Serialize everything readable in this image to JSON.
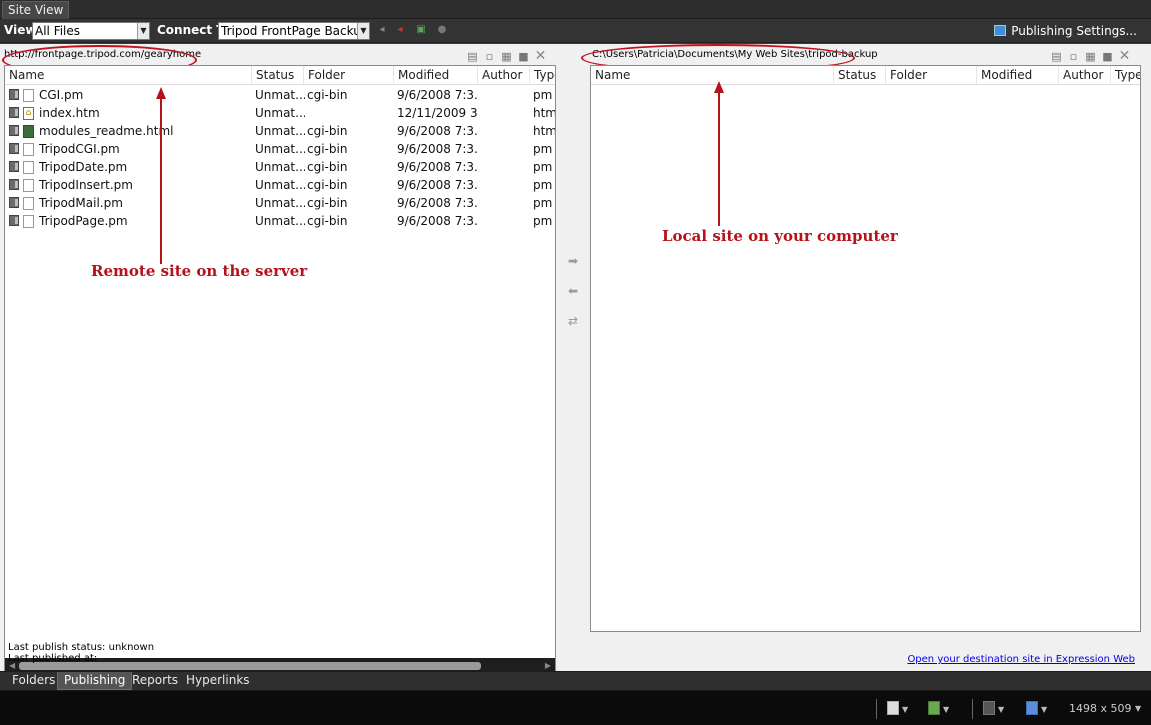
{
  "window": {
    "tab_label": "Site View"
  },
  "toolbar": {
    "view_label": "View",
    "view_value": "All Files",
    "connect_label": "Connect To:",
    "connect_value": "Tripod FrontPage Backup",
    "publishing_settings": "Publishing Settings..."
  },
  "remote": {
    "path": "http://frontpage.tripod.com/gearyhome",
    "columns": [
      "Name",
      "Status",
      "Folder",
      "Modified",
      "Author",
      "Type"
    ],
    "rows": [
      {
        "name": "CGI.pm",
        "status": "Unmat...",
        "folder": "cgi-bin",
        "modified": "9/6/2008 7:3...",
        "author": "",
        "type": "pm",
        "icon": "file-icon"
      },
      {
        "name": "index.htm",
        "status": "Unmat...",
        "folder": "",
        "modified": "12/11/2009 3...",
        "author": "",
        "type": "htm",
        "icon": "home-page-icon"
      },
      {
        "name": "modules_readme.html",
        "status": "Unmat...",
        "folder": "cgi-bin",
        "modified": "9/6/2008 7:3...",
        "author": "",
        "type": "html",
        "icon": "html-file-icon"
      },
      {
        "name": "TripodCGI.pm",
        "status": "Unmat...",
        "folder": "cgi-bin",
        "modified": "9/6/2008 7:3...",
        "author": "",
        "type": "pm",
        "icon": "file-icon"
      },
      {
        "name": "TripodDate.pm",
        "status": "Unmat...",
        "folder": "cgi-bin",
        "modified": "9/6/2008 7:3...",
        "author": "",
        "type": "pm",
        "icon": "file-icon"
      },
      {
        "name": "TripodInsert.pm",
        "status": "Unmat...",
        "folder": "cgi-bin",
        "modified": "9/6/2008 7:3...",
        "author": "",
        "type": "pm",
        "icon": "file-icon"
      },
      {
        "name": "TripodMail.pm",
        "status": "Unmat...",
        "folder": "cgi-bin",
        "modified": "9/6/2008 7:3...",
        "author": "",
        "type": "pm",
        "icon": "file-icon"
      },
      {
        "name": "TripodPage.pm",
        "status": "Unmat...",
        "folder": "cgi-bin",
        "modified": "9/6/2008 7:3...",
        "author": "",
        "type": "pm",
        "icon": "file-icon"
      }
    ]
  },
  "local": {
    "path": "C:\\Users\\Patricia\\Documents\\My Web Sites\\tripod-backup",
    "columns": [
      "Name",
      "Status",
      "Folder",
      "Modified",
      "Author",
      "Type"
    ]
  },
  "annotations": {
    "remote": "Remote site on the server",
    "local": "Local site on your computer",
    "color": "#b5121b"
  },
  "status": {
    "last_publish_status": "Last publish status: unknown",
    "last_published_at": "Last published at:",
    "destination_link": "Open your destination site in Expression Web"
  },
  "bottom_tabs": [
    {
      "label": "Folders",
      "active": false
    },
    {
      "label": "Publishing",
      "active": true
    },
    {
      "label": "Reports",
      "active": false
    },
    {
      "label": "Hyperlinks",
      "active": false
    }
  ],
  "statusbar": {
    "dimensions": "1498 x 509"
  }
}
